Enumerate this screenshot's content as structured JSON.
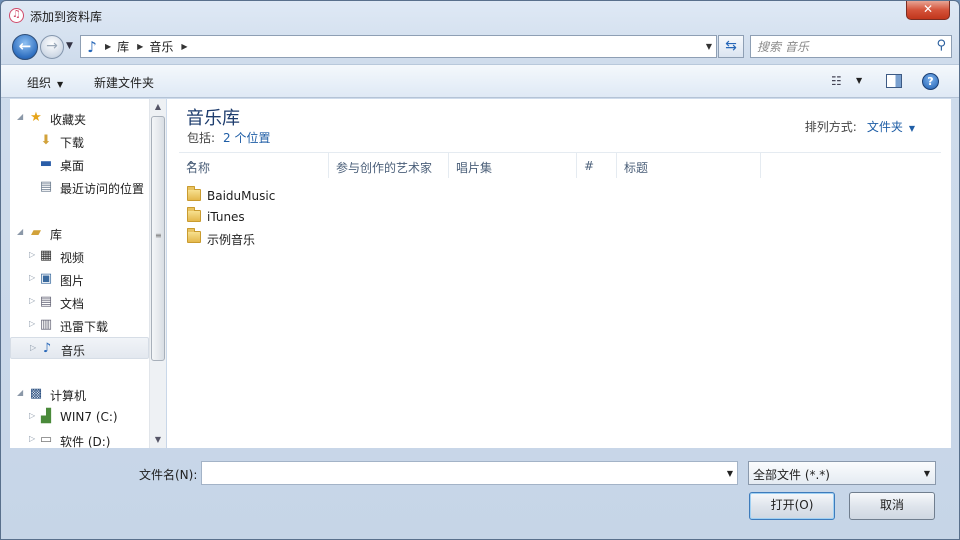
{
  "window": {
    "title": "添加到资料库",
    "close_label": "✕"
  },
  "address": {
    "breadcrumbs": [
      "库",
      "音乐"
    ],
    "search_placeholder": "搜索 音乐"
  },
  "toolbar": {
    "organize_label": "组织",
    "new_folder_label": "新建文件夹"
  },
  "sidebar": {
    "items": [
      {
        "label": "收藏夹",
        "icon": "star-icon",
        "level": 0
      },
      {
        "label": "下载",
        "icon": "download-folder-icon",
        "level": 1
      },
      {
        "label": "桌面",
        "icon": "desktop-icon",
        "level": 1
      },
      {
        "label": "最近访问的位置",
        "icon": "recent-places-icon",
        "level": 1
      },
      {
        "label": "库",
        "icon": "library-icon",
        "level": 0
      },
      {
        "label": "视频",
        "icon": "video-icon",
        "level": 1
      },
      {
        "label": "图片",
        "icon": "pictures-icon",
        "level": 1
      },
      {
        "label": "文档",
        "icon": "documents-icon",
        "level": 1
      },
      {
        "label": "迅雷下载",
        "icon": "thunder-download-icon",
        "level": 1
      },
      {
        "label": "音乐",
        "icon": "music-icon",
        "level": 1,
        "selected": true
      },
      {
        "label": "计算机",
        "icon": "computer-icon",
        "level": 0
      },
      {
        "label": "WIN7 (C:)",
        "icon": "system-drive-icon",
        "level": 1
      },
      {
        "label": "软件 (D:)",
        "icon": "drive-icon",
        "level": 1
      }
    ]
  },
  "content": {
    "title": "音乐库",
    "includes_label": "包括:",
    "includes_link": "2 个位置",
    "arrange_label": "排列方式:",
    "arrange_value": "文件夹",
    "columns": [
      "名称",
      "参与创作的艺术家",
      "唱片集",
      "#",
      "标题"
    ],
    "files": [
      {
        "name": "BaiduMusic",
        "icon": "folder-icon"
      },
      {
        "name": "iTunes",
        "icon": "folder-icon"
      },
      {
        "name": "示例音乐",
        "icon": "folder-icon"
      }
    ]
  },
  "footer": {
    "filename_label": "文件名(N):",
    "filename_value": "",
    "filetype_value": "全部文件 (*.*)",
    "open_label": "打开(O)",
    "cancel_label": "取消"
  },
  "colors": {
    "accent": "#1f5ea6",
    "title_blue": "#1e3d6e",
    "close_red": "#c8412a"
  }
}
